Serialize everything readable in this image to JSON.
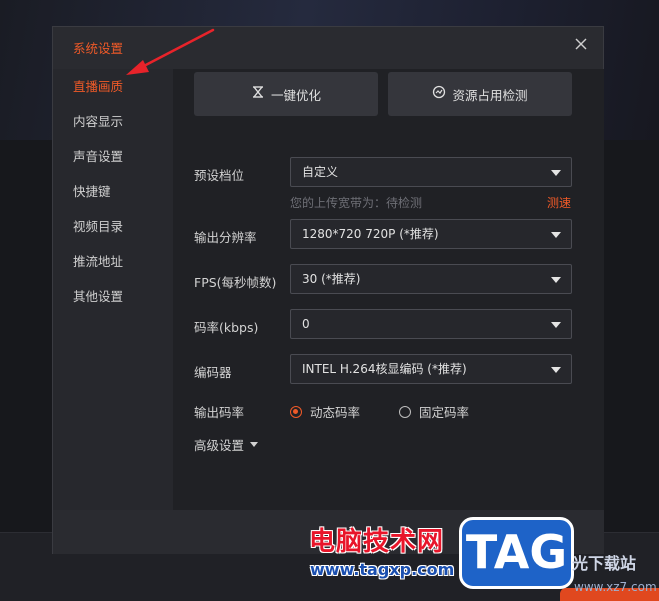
{
  "dialog": {
    "title": "系统设置",
    "close_icon": "close-icon"
  },
  "sidebar": {
    "items": [
      {
        "label": "直播画质",
        "active": true
      },
      {
        "label": "内容显示",
        "active": false
      },
      {
        "label": "声音设置",
        "active": false
      },
      {
        "label": "快捷键",
        "active": false
      },
      {
        "label": "视频目录",
        "active": false
      },
      {
        "label": "推流地址",
        "active": false
      },
      {
        "label": "其他设置",
        "active": false
      }
    ]
  },
  "toolbar": {
    "optimize_label": "一键优化",
    "optimize_icon": "optimize-icon",
    "resource_label": "资源占用检测",
    "resource_icon": "resource-monitor-icon"
  },
  "settings": {
    "preset": {
      "label": "预设档位",
      "value": "自定义"
    },
    "upload_hint": "您的上传宽带为：待检测",
    "speed_test_label": "测速",
    "resolution": {
      "label": "输出分辨率",
      "value": "1280*720 720P (*推荐)"
    },
    "fps": {
      "label": "FPS(每秒帧数)",
      "value": "30 (*推荐)"
    },
    "bitrate": {
      "label": "码率(kbps)",
      "value": "0"
    },
    "encoder": {
      "label": "编码器",
      "value": "INTEL H.264核显编码 (*推荐)"
    },
    "rate_mode": {
      "label": "输出码率",
      "options": [
        {
          "label": "动态码率",
          "selected": true
        },
        {
          "label": "固定码率",
          "selected": false
        }
      ]
    },
    "advanced_label": "高级设置"
  },
  "watermark": {
    "site_name": "电脑技术网",
    "url": "www.tagxp.com",
    "logo_text": "TAG",
    "side_text": "光下载站",
    "side_url": "www.xz7.com"
  },
  "colors": {
    "accent": "#f05a28",
    "dialog_bg": "#2a2b30",
    "content_bg": "#202125",
    "annotation_arrow": "#e8232a"
  }
}
